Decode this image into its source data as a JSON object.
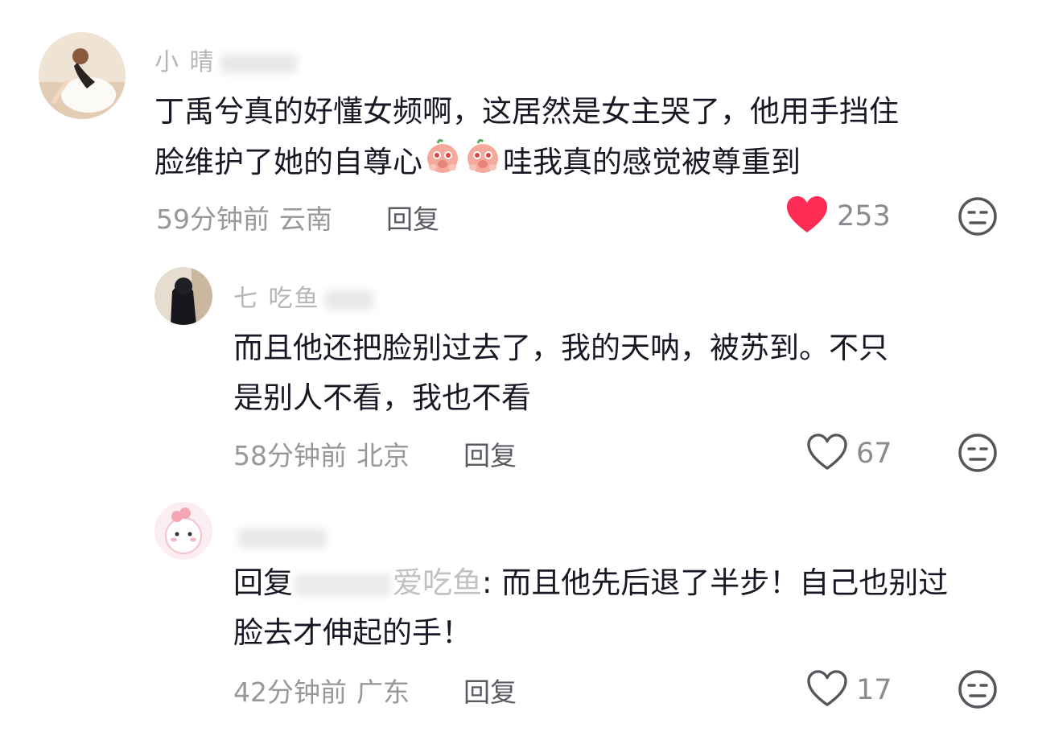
{
  "comments": [
    {
      "username": "小 晴",
      "text_line1": "丁禹兮真的好懂女频啊，这居然是女主哭了，他用手挡住",
      "text_line2_a": "脸维护了她的自尊心",
      "text_line2_b": "哇我真的感觉被尊重到",
      "emoji": "flushed-peach-emoji",
      "time": "59分钟前",
      "location": "云南",
      "reply_label": "回复",
      "likes": "253",
      "liked": true
    },
    {
      "username": "七 吃鱼",
      "text_line1": "而且他还把脸别过去了，我的天呐，被苏到。不只",
      "text_line2": "是别人不看，我也不看",
      "time": "58分钟前",
      "location": "北京",
      "reply_label": "回复",
      "likes": "67",
      "liked": false
    },
    {
      "username": "",
      "reply_prefix": "回复",
      "mention_suffix": "爱吃鱼",
      "text_line1_rest": ": 而且他先后退了半步！自己也别过",
      "text_line2": "脸去才伸起的手！",
      "time": "42分钟前",
      "location": "广东",
      "reply_label": "回复",
      "likes": "17",
      "liked": false
    }
  ],
  "colors": {
    "like_active": "#fe2c55",
    "text_primary": "#161823",
    "text_secondary": "#97989c"
  }
}
